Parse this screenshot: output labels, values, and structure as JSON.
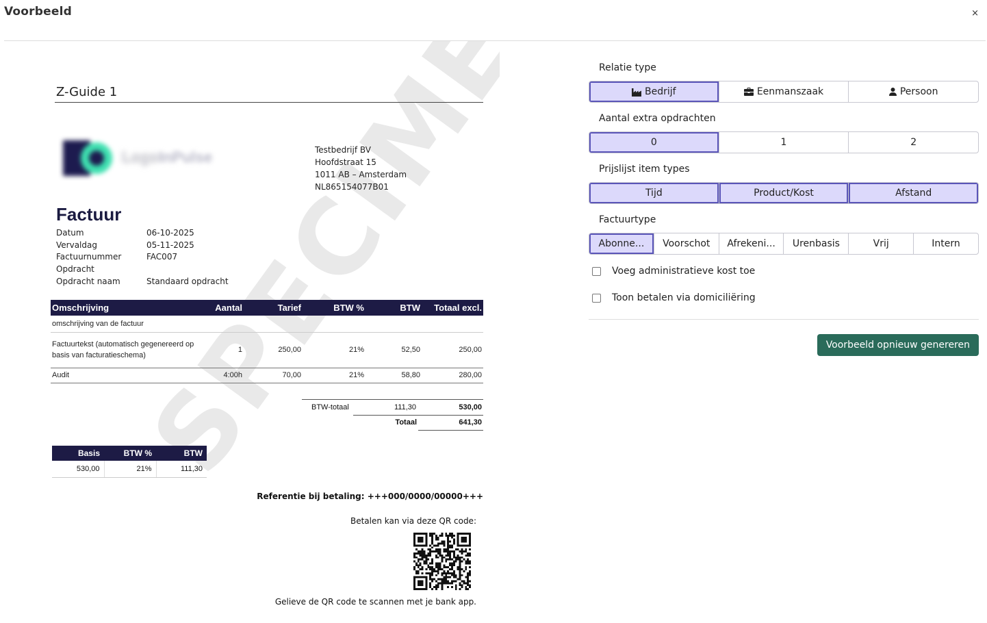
{
  "modal": {
    "title": "Voorbeeld",
    "close": "×"
  },
  "invoice": {
    "company_title": "Z-Guide 1",
    "logo": {
      "text_primary": "Logo",
      "text_secondary": "InPulse",
      "colors": {
        "dark": "#1d1b4f",
        "accent": "#3ee0b0"
      }
    },
    "address": [
      "Testbedrijf BV",
      "Hoofdstraat 15",
      "1011 AB – Amsterdam",
      "NL865154077B01"
    ],
    "doc_type": "Factuur",
    "meta": [
      {
        "label": "Datum",
        "value": "06-10-2025"
      },
      {
        "label": "Vervaldag",
        "value": "05-11-2025"
      },
      {
        "label": "Factuurnummer",
        "value": "FAC007"
      },
      {
        "label": "Opdracht",
        "value": ""
      },
      {
        "label": "Opdracht naam",
        "value": "Standaard opdracht"
      }
    ],
    "lines": {
      "headers": [
        "Omschrijving",
        "Aantal",
        "Tarief",
        "BTW %",
        "BTW",
        "Totaal excl."
      ],
      "description": "omschrijving van de factuur",
      "rows": [
        {
          "desc": "Factuurtekst (automatisch gegenereerd op basis van facturatieschema)",
          "qty": "1",
          "rate": "250,00",
          "vat_pct": "21%",
          "vat": "52,50",
          "total": "250,00"
        },
        {
          "desc": "Audit",
          "qty": "4:00h",
          "rate": "70,00",
          "vat_pct": "21%",
          "vat": "58,80",
          "total": "280,00"
        }
      ]
    },
    "totals": {
      "vat_label": "BTW-totaal",
      "vat_value": "111,30",
      "excl_value": "530,00",
      "total_label": "Totaal",
      "total_value": "641,30"
    },
    "vat_table": {
      "headers": [
        "Basis",
        "BTW %",
        "BTW"
      ],
      "row": [
        "530,00",
        "21%",
        "111,30"
      ]
    },
    "payment": {
      "reference_label": "Referentie bij betaling:",
      "reference_value": "+++000/0000/00000+++",
      "qr_text": "Betalen kan via deze QR code:",
      "qr_scan": "Gelieve de QR code te scannen met je bank app."
    },
    "watermark": "SPECIMEN"
  },
  "panel": {
    "relatie": {
      "label": "Relatie type",
      "options": [
        {
          "label": "Bedrijf",
          "icon": "industry-icon",
          "active": true
        },
        {
          "label": "Eenmanszaak",
          "icon": "briefcase-icon",
          "active": false
        },
        {
          "label": "Persoon",
          "icon": "user-icon",
          "active": false
        }
      ]
    },
    "opdrachten": {
      "label": "Aantal extra opdrachten",
      "options": [
        {
          "label": "0",
          "active": true
        },
        {
          "label": "1",
          "active": false
        },
        {
          "label": "2",
          "active": false
        }
      ]
    },
    "item_types": {
      "label": "Prijslijst item types",
      "options": [
        {
          "label": "Tijd",
          "active": true
        },
        {
          "label": "Product/Kost",
          "active": true
        },
        {
          "label": "Afstand",
          "active": true
        }
      ]
    },
    "factuurtype": {
      "label": "Factuurtype",
      "options": [
        {
          "label": "Abonne...",
          "active": true
        },
        {
          "label": "Voorschot",
          "active": false
        },
        {
          "label": "Afrekeni...",
          "active": false
        },
        {
          "label": "Urenbasis",
          "active": false
        },
        {
          "label": "Vrij",
          "active": false
        },
        {
          "label": "Intern",
          "active": false
        }
      ]
    },
    "checkboxes": [
      {
        "label": "Voeg administratieve kost toe",
        "checked": false
      },
      {
        "label": "Toon betalen via domiciliëring",
        "checked": false
      }
    ],
    "regenerate": "Voorbeeld opnieuw genereren",
    "colors": {
      "active_bg": "#dcd9fb",
      "active_border": "#5a55b8",
      "button": "#2a6b5a"
    }
  }
}
